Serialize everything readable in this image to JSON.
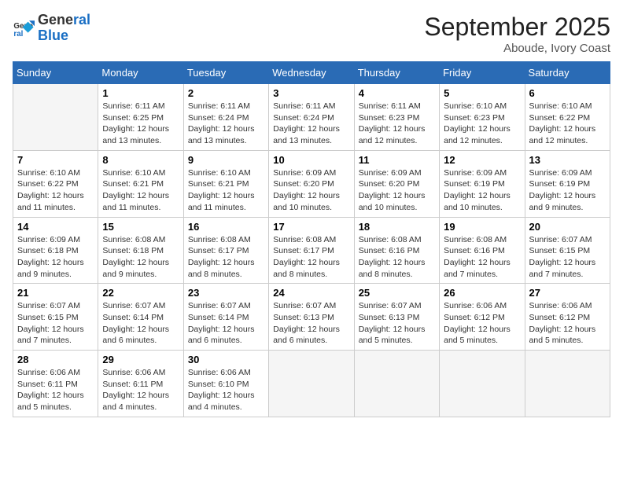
{
  "logo": {
    "line1": "General",
    "line2": "Blue"
  },
  "title": "September 2025",
  "location": "Aboude, Ivory Coast",
  "weekdays": [
    "Sunday",
    "Monday",
    "Tuesday",
    "Wednesday",
    "Thursday",
    "Friday",
    "Saturday"
  ],
  "weeks": [
    [
      {
        "day": "",
        "sunrise": "",
        "sunset": "",
        "daylight": ""
      },
      {
        "day": "1",
        "sunrise": "Sunrise: 6:11 AM",
        "sunset": "Sunset: 6:25 PM",
        "daylight": "Daylight: 12 hours and 13 minutes."
      },
      {
        "day": "2",
        "sunrise": "Sunrise: 6:11 AM",
        "sunset": "Sunset: 6:24 PM",
        "daylight": "Daylight: 12 hours and 13 minutes."
      },
      {
        "day": "3",
        "sunrise": "Sunrise: 6:11 AM",
        "sunset": "Sunset: 6:24 PM",
        "daylight": "Daylight: 12 hours and 13 minutes."
      },
      {
        "day": "4",
        "sunrise": "Sunrise: 6:11 AM",
        "sunset": "Sunset: 6:23 PM",
        "daylight": "Daylight: 12 hours and 12 minutes."
      },
      {
        "day": "5",
        "sunrise": "Sunrise: 6:10 AM",
        "sunset": "Sunset: 6:23 PM",
        "daylight": "Daylight: 12 hours and 12 minutes."
      },
      {
        "day": "6",
        "sunrise": "Sunrise: 6:10 AM",
        "sunset": "Sunset: 6:22 PM",
        "daylight": "Daylight: 12 hours and 12 minutes."
      }
    ],
    [
      {
        "day": "7",
        "sunrise": "Sunrise: 6:10 AM",
        "sunset": "Sunset: 6:22 PM",
        "daylight": "Daylight: 12 hours and 11 minutes."
      },
      {
        "day": "8",
        "sunrise": "Sunrise: 6:10 AM",
        "sunset": "Sunset: 6:21 PM",
        "daylight": "Daylight: 12 hours and 11 minutes."
      },
      {
        "day": "9",
        "sunrise": "Sunrise: 6:10 AM",
        "sunset": "Sunset: 6:21 PM",
        "daylight": "Daylight: 12 hours and 11 minutes."
      },
      {
        "day": "10",
        "sunrise": "Sunrise: 6:09 AM",
        "sunset": "Sunset: 6:20 PM",
        "daylight": "Daylight: 12 hours and 10 minutes."
      },
      {
        "day": "11",
        "sunrise": "Sunrise: 6:09 AM",
        "sunset": "Sunset: 6:20 PM",
        "daylight": "Daylight: 12 hours and 10 minutes."
      },
      {
        "day": "12",
        "sunrise": "Sunrise: 6:09 AM",
        "sunset": "Sunset: 6:19 PM",
        "daylight": "Daylight: 12 hours and 10 minutes."
      },
      {
        "day": "13",
        "sunrise": "Sunrise: 6:09 AM",
        "sunset": "Sunset: 6:19 PM",
        "daylight": "Daylight: 12 hours and 9 minutes."
      }
    ],
    [
      {
        "day": "14",
        "sunrise": "Sunrise: 6:09 AM",
        "sunset": "Sunset: 6:18 PM",
        "daylight": "Daylight: 12 hours and 9 minutes."
      },
      {
        "day": "15",
        "sunrise": "Sunrise: 6:08 AM",
        "sunset": "Sunset: 6:18 PM",
        "daylight": "Daylight: 12 hours and 9 minutes."
      },
      {
        "day": "16",
        "sunrise": "Sunrise: 6:08 AM",
        "sunset": "Sunset: 6:17 PM",
        "daylight": "Daylight: 12 hours and 8 minutes."
      },
      {
        "day": "17",
        "sunrise": "Sunrise: 6:08 AM",
        "sunset": "Sunset: 6:17 PM",
        "daylight": "Daylight: 12 hours and 8 minutes."
      },
      {
        "day": "18",
        "sunrise": "Sunrise: 6:08 AM",
        "sunset": "Sunset: 6:16 PM",
        "daylight": "Daylight: 12 hours and 8 minutes."
      },
      {
        "day": "19",
        "sunrise": "Sunrise: 6:08 AM",
        "sunset": "Sunset: 6:16 PM",
        "daylight": "Daylight: 12 hours and 7 minutes."
      },
      {
        "day": "20",
        "sunrise": "Sunrise: 6:07 AM",
        "sunset": "Sunset: 6:15 PM",
        "daylight": "Daylight: 12 hours and 7 minutes."
      }
    ],
    [
      {
        "day": "21",
        "sunrise": "Sunrise: 6:07 AM",
        "sunset": "Sunset: 6:15 PM",
        "daylight": "Daylight: 12 hours and 7 minutes."
      },
      {
        "day": "22",
        "sunrise": "Sunrise: 6:07 AM",
        "sunset": "Sunset: 6:14 PM",
        "daylight": "Daylight: 12 hours and 6 minutes."
      },
      {
        "day": "23",
        "sunrise": "Sunrise: 6:07 AM",
        "sunset": "Sunset: 6:14 PM",
        "daylight": "Daylight: 12 hours and 6 minutes."
      },
      {
        "day": "24",
        "sunrise": "Sunrise: 6:07 AM",
        "sunset": "Sunset: 6:13 PM",
        "daylight": "Daylight: 12 hours and 6 minutes."
      },
      {
        "day": "25",
        "sunrise": "Sunrise: 6:07 AM",
        "sunset": "Sunset: 6:13 PM",
        "daylight": "Daylight: 12 hours and 5 minutes."
      },
      {
        "day": "26",
        "sunrise": "Sunrise: 6:06 AM",
        "sunset": "Sunset: 6:12 PM",
        "daylight": "Daylight: 12 hours and 5 minutes."
      },
      {
        "day": "27",
        "sunrise": "Sunrise: 6:06 AM",
        "sunset": "Sunset: 6:12 PM",
        "daylight": "Daylight: 12 hours and 5 minutes."
      }
    ],
    [
      {
        "day": "28",
        "sunrise": "Sunrise: 6:06 AM",
        "sunset": "Sunset: 6:11 PM",
        "daylight": "Daylight: 12 hours and 5 minutes."
      },
      {
        "day": "29",
        "sunrise": "Sunrise: 6:06 AM",
        "sunset": "Sunset: 6:11 PM",
        "daylight": "Daylight: 12 hours and 4 minutes."
      },
      {
        "day": "30",
        "sunrise": "Sunrise: 6:06 AM",
        "sunset": "Sunset: 6:10 PM",
        "daylight": "Daylight: 12 hours and 4 minutes."
      },
      {
        "day": "",
        "sunrise": "",
        "sunset": "",
        "daylight": ""
      },
      {
        "day": "",
        "sunrise": "",
        "sunset": "",
        "daylight": ""
      },
      {
        "day": "",
        "sunrise": "",
        "sunset": "",
        "daylight": ""
      },
      {
        "day": "",
        "sunrise": "",
        "sunset": "",
        "daylight": ""
      }
    ]
  ]
}
